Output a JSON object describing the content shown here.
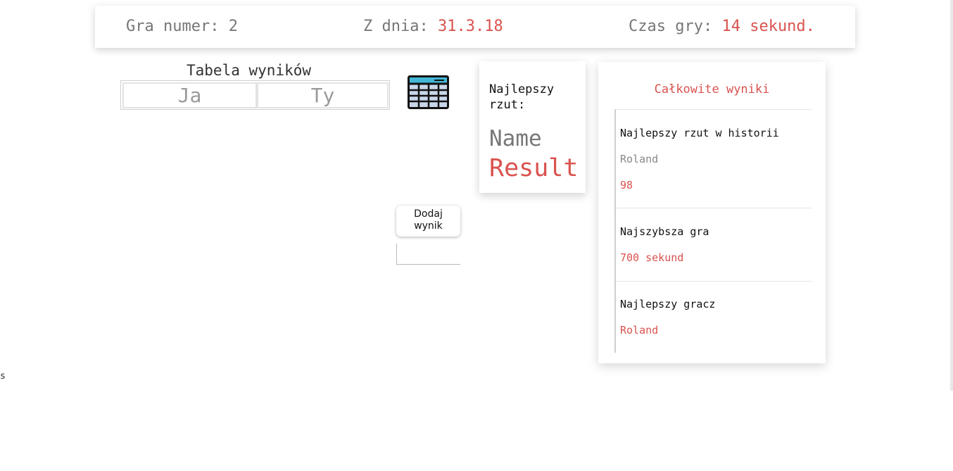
{
  "header": {
    "game_label": "Gra numer:",
    "game_value": "2",
    "date_label": "Z dnia:",
    "date_value": "31.3.18",
    "time_label": "Czas gry:",
    "time_value": "14 sekund."
  },
  "score_table": {
    "title": "Tabela wyników",
    "columns": [
      "Ja",
      "Ty"
    ]
  },
  "add_score": {
    "button_label": "Dodaj wynik",
    "input_value": ""
  },
  "best_throw": {
    "label": "Najlepszy rzut:",
    "name": "Name",
    "result": "Result"
  },
  "totals": {
    "title": "Całkowite wyniki",
    "sections": [
      {
        "heading": "Najlepszy rzut w historii",
        "player": "Roland",
        "value": "98"
      },
      {
        "heading": "Najszybsza gra",
        "value": "700 sekund"
      },
      {
        "heading": "Najlepszy gracz",
        "value": "Roland"
      }
    ]
  },
  "stray_text": "s",
  "icons": {
    "table": "table-icon"
  },
  "colors": {
    "accent": "#d9534f",
    "muted": "#777777"
  }
}
